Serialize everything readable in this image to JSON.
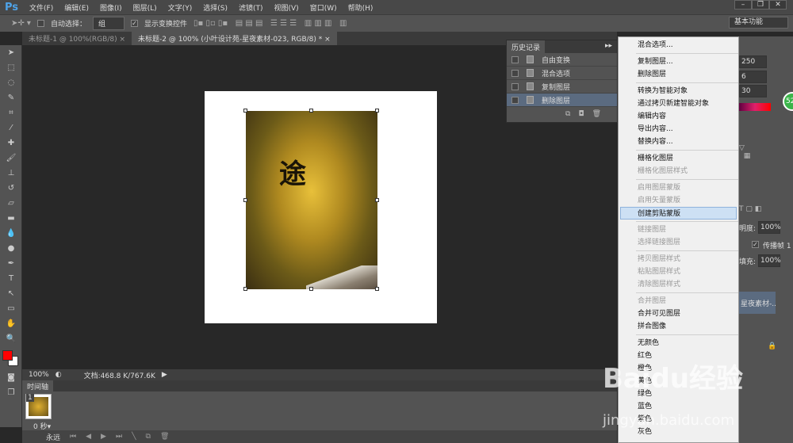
{
  "app": {
    "logo": "Ps",
    "menus": [
      "文件(F)",
      "编辑(E)",
      "图像(I)",
      "图层(L)",
      "文字(Y)",
      "选择(S)",
      "滤镜(T)",
      "视图(V)",
      "窗口(W)",
      "帮助(H)"
    ]
  },
  "options": {
    "auto_select": "自动选择：",
    "auto_select_value": "组",
    "show_transform": "显示变换控件",
    "workspace": "基本功能"
  },
  "tabs": [
    {
      "label": "未标题-1 @ 100%(RGB/8)",
      "close": "×"
    },
    {
      "label": "未标题-2 @ 100% (小叶设计苑-星夜素材-023, RGB/8) *",
      "close": "×"
    }
  ],
  "canvas": {
    "character": "途"
  },
  "history": {
    "title": "历史记录",
    "items": [
      "自由变换",
      "混合选项",
      "复制图层",
      "删除图层"
    ]
  },
  "context_menu": {
    "groups": [
      [
        {
          "label": "混合选项...",
          "enabled": true
        }
      ],
      [
        {
          "label": "复制图层...",
          "enabled": true
        },
        {
          "label": "删除图层",
          "enabled": true
        }
      ],
      [
        {
          "label": "转换为智能对象",
          "enabled": true
        },
        {
          "label": "通过拷贝新建智能对象",
          "enabled": true
        },
        {
          "label": "编辑内容",
          "enabled": true
        },
        {
          "label": "导出内容...",
          "enabled": true
        },
        {
          "label": "替换内容...",
          "enabled": true
        }
      ],
      [
        {
          "label": "栅格化图层",
          "enabled": true
        },
        {
          "label": "栅格化图层样式",
          "enabled": false
        }
      ],
      [
        {
          "label": "启用图层蒙版",
          "enabled": false
        },
        {
          "label": "启用矢量蒙版",
          "enabled": false
        },
        {
          "label": "创建剪贴蒙版",
          "enabled": true,
          "highlighted": true
        }
      ],
      [
        {
          "label": "链接图层",
          "enabled": false
        },
        {
          "label": "选择链接图层",
          "enabled": false
        }
      ],
      [
        {
          "label": "拷贝图层样式",
          "enabled": false
        },
        {
          "label": "粘贴图层样式",
          "enabled": false
        },
        {
          "label": "清除图层样式",
          "enabled": false
        }
      ],
      [
        {
          "label": "合并图层",
          "enabled": false
        },
        {
          "label": "合并可见图层",
          "enabled": true
        },
        {
          "label": "拼合图像",
          "enabled": true
        }
      ],
      [
        {
          "label": "无颜色",
          "enabled": true
        },
        {
          "label": "红色",
          "enabled": true
        },
        {
          "label": "橙色",
          "enabled": true
        },
        {
          "label": "黄色",
          "enabled": true
        },
        {
          "label": "绿色",
          "enabled": true
        },
        {
          "label": "蓝色",
          "enabled": true
        },
        {
          "label": "紫色",
          "enabled": true
        },
        {
          "label": "灰色",
          "enabled": true
        }
      ]
    ]
  },
  "right_panel": {
    "r": "250",
    "g": "6",
    "b": "30",
    "badge": "52",
    "opacity_label": "明度:",
    "opacity": "100%",
    "propagate": "传播帧",
    "propagate_num": "1",
    "fill_label": "填充:",
    "fill": "100%",
    "layer_name": "星夜素材-..."
  },
  "status": {
    "zoom": "100%",
    "doc": "文档:468.8 K/767.6K"
  },
  "timeline": {
    "title": "时间轴",
    "frame_num": "1",
    "frame_delay": "0 秒▾",
    "loop": "永远"
  },
  "watermark": {
    "brand": "Baidu经验",
    "url": "jingyan.baidu.com"
  },
  "colors": {
    "foreground": "#ff0000",
    "background": "#ffffff",
    "accent": "#4ea3e8"
  }
}
